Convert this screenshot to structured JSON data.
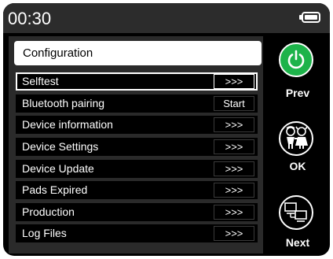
{
  "status": {
    "time": "00:30"
  },
  "menu": {
    "title": "Configuration",
    "items": [
      {
        "label": "Selftest",
        "action": ">>>"
      },
      {
        "label": "Bluetooth pairing",
        "action": "Start"
      },
      {
        "label": "Device information",
        "action": ">>>"
      },
      {
        "label": "Device Settings",
        "action": ">>>"
      },
      {
        "label": "Device Update",
        "action": ">>>"
      },
      {
        "label": "Pads Expired",
        "action": ">>>"
      },
      {
        "label": "Production",
        "action": ">>>"
      },
      {
        "label": "Log Files",
        "action": ">>>"
      }
    ],
    "selected_item": "Selftest"
  },
  "side_buttons": {
    "prev": {
      "label": "Prev",
      "icon": "power-icon"
    },
    "ok": {
      "label": "OK",
      "icon": "children-icon"
    },
    "next": {
      "label": "Next",
      "icon": "computers-icon"
    }
  },
  "colors": {
    "power_green": "#1db34a",
    "panel": "#2a2a2a",
    "status_bar": "#2c2c2c"
  }
}
